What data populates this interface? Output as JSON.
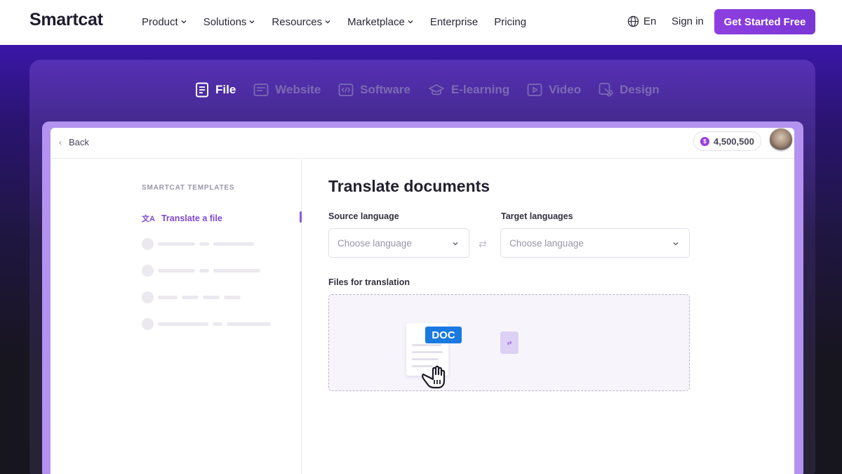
{
  "header": {
    "logo": "Smartcat",
    "nav": [
      {
        "label": "Product",
        "dropdown": true
      },
      {
        "label": "Solutions",
        "dropdown": true
      },
      {
        "label": "Resources",
        "dropdown": true
      },
      {
        "label": "Marketplace",
        "dropdown": true
      },
      {
        "label": "Enterprise",
        "dropdown": false
      },
      {
        "label": "Pricing",
        "dropdown": false
      }
    ],
    "language": "En",
    "sign_in": "Sign in",
    "cta": "Get Started Free"
  },
  "tabs": [
    {
      "label": "File",
      "icon": "file-icon",
      "active": true
    },
    {
      "label": "Website",
      "icon": "website-icon",
      "active": false
    },
    {
      "label": "Software",
      "icon": "code-icon",
      "active": false
    },
    {
      "label": "E-learning",
      "icon": "graduation-cap-icon",
      "active": false
    },
    {
      "label": "Video",
      "icon": "play-icon",
      "active": false
    },
    {
      "label": "Design",
      "icon": "pen-tool-icon",
      "active": false
    }
  ],
  "app": {
    "back": "Back",
    "credits": "4,500,500",
    "sidebar": {
      "heading": "SMARTCAT TEMPLATES",
      "active_item": "Translate a file"
    },
    "main": {
      "title": "Translate documents",
      "source_label": "Source language",
      "source_placeholder": "Choose language",
      "target_label": "Target languages",
      "target_placeholder": "Choose language",
      "files_label": "Files for translation",
      "doc_badge": "DOC"
    }
  },
  "colors": {
    "accent": "#8a3ddb",
    "brand_text": "#1f1b2e",
    "doc_badge": "#1a7ae0"
  }
}
